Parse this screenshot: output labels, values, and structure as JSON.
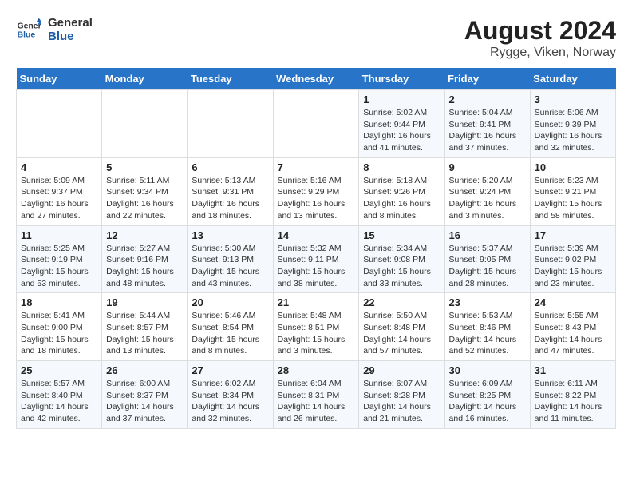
{
  "header": {
    "logo_line1": "General",
    "logo_line2": "Blue",
    "title": "August 2024",
    "subtitle": "Rygge, Viken, Norway"
  },
  "days_of_week": [
    "Sunday",
    "Monday",
    "Tuesday",
    "Wednesday",
    "Thursday",
    "Friday",
    "Saturday"
  ],
  "weeks": [
    [
      {
        "day": "",
        "info": ""
      },
      {
        "day": "",
        "info": ""
      },
      {
        "day": "",
        "info": ""
      },
      {
        "day": "",
        "info": ""
      },
      {
        "day": "1",
        "info": "Sunrise: 5:02 AM\nSunset: 9:44 PM\nDaylight: 16 hours\nand 41 minutes."
      },
      {
        "day": "2",
        "info": "Sunrise: 5:04 AM\nSunset: 9:41 PM\nDaylight: 16 hours\nand 37 minutes."
      },
      {
        "day": "3",
        "info": "Sunrise: 5:06 AM\nSunset: 9:39 PM\nDaylight: 16 hours\nand 32 minutes."
      }
    ],
    [
      {
        "day": "4",
        "info": "Sunrise: 5:09 AM\nSunset: 9:37 PM\nDaylight: 16 hours\nand 27 minutes."
      },
      {
        "day": "5",
        "info": "Sunrise: 5:11 AM\nSunset: 9:34 PM\nDaylight: 16 hours\nand 22 minutes."
      },
      {
        "day": "6",
        "info": "Sunrise: 5:13 AM\nSunset: 9:31 PM\nDaylight: 16 hours\nand 18 minutes."
      },
      {
        "day": "7",
        "info": "Sunrise: 5:16 AM\nSunset: 9:29 PM\nDaylight: 16 hours\nand 13 minutes."
      },
      {
        "day": "8",
        "info": "Sunrise: 5:18 AM\nSunset: 9:26 PM\nDaylight: 16 hours\nand 8 minutes."
      },
      {
        "day": "9",
        "info": "Sunrise: 5:20 AM\nSunset: 9:24 PM\nDaylight: 16 hours\nand 3 minutes."
      },
      {
        "day": "10",
        "info": "Sunrise: 5:23 AM\nSunset: 9:21 PM\nDaylight: 15 hours\nand 58 minutes."
      }
    ],
    [
      {
        "day": "11",
        "info": "Sunrise: 5:25 AM\nSunset: 9:19 PM\nDaylight: 15 hours\nand 53 minutes."
      },
      {
        "day": "12",
        "info": "Sunrise: 5:27 AM\nSunset: 9:16 PM\nDaylight: 15 hours\nand 48 minutes."
      },
      {
        "day": "13",
        "info": "Sunrise: 5:30 AM\nSunset: 9:13 PM\nDaylight: 15 hours\nand 43 minutes."
      },
      {
        "day": "14",
        "info": "Sunrise: 5:32 AM\nSunset: 9:11 PM\nDaylight: 15 hours\nand 38 minutes."
      },
      {
        "day": "15",
        "info": "Sunrise: 5:34 AM\nSunset: 9:08 PM\nDaylight: 15 hours\nand 33 minutes."
      },
      {
        "day": "16",
        "info": "Sunrise: 5:37 AM\nSunset: 9:05 PM\nDaylight: 15 hours\nand 28 minutes."
      },
      {
        "day": "17",
        "info": "Sunrise: 5:39 AM\nSunset: 9:02 PM\nDaylight: 15 hours\nand 23 minutes."
      }
    ],
    [
      {
        "day": "18",
        "info": "Sunrise: 5:41 AM\nSunset: 9:00 PM\nDaylight: 15 hours\nand 18 minutes."
      },
      {
        "day": "19",
        "info": "Sunrise: 5:44 AM\nSunset: 8:57 PM\nDaylight: 15 hours\nand 13 minutes."
      },
      {
        "day": "20",
        "info": "Sunrise: 5:46 AM\nSunset: 8:54 PM\nDaylight: 15 hours\nand 8 minutes."
      },
      {
        "day": "21",
        "info": "Sunrise: 5:48 AM\nSunset: 8:51 PM\nDaylight: 15 hours\nand 3 minutes."
      },
      {
        "day": "22",
        "info": "Sunrise: 5:50 AM\nSunset: 8:48 PM\nDaylight: 14 hours\nand 57 minutes."
      },
      {
        "day": "23",
        "info": "Sunrise: 5:53 AM\nSunset: 8:46 PM\nDaylight: 14 hours\nand 52 minutes."
      },
      {
        "day": "24",
        "info": "Sunrise: 5:55 AM\nSunset: 8:43 PM\nDaylight: 14 hours\nand 47 minutes."
      }
    ],
    [
      {
        "day": "25",
        "info": "Sunrise: 5:57 AM\nSunset: 8:40 PM\nDaylight: 14 hours\nand 42 minutes."
      },
      {
        "day": "26",
        "info": "Sunrise: 6:00 AM\nSunset: 8:37 PM\nDaylight: 14 hours\nand 37 minutes."
      },
      {
        "day": "27",
        "info": "Sunrise: 6:02 AM\nSunset: 8:34 PM\nDaylight: 14 hours\nand 32 minutes."
      },
      {
        "day": "28",
        "info": "Sunrise: 6:04 AM\nSunset: 8:31 PM\nDaylight: 14 hours\nand 26 minutes."
      },
      {
        "day": "29",
        "info": "Sunrise: 6:07 AM\nSunset: 8:28 PM\nDaylight: 14 hours\nand 21 minutes."
      },
      {
        "day": "30",
        "info": "Sunrise: 6:09 AM\nSunset: 8:25 PM\nDaylight: 14 hours\nand 16 minutes."
      },
      {
        "day": "31",
        "info": "Sunrise: 6:11 AM\nSunset: 8:22 PM\nDaylight: 14 hours\nand 11 minutes."
      }
    ]
  ]
}
